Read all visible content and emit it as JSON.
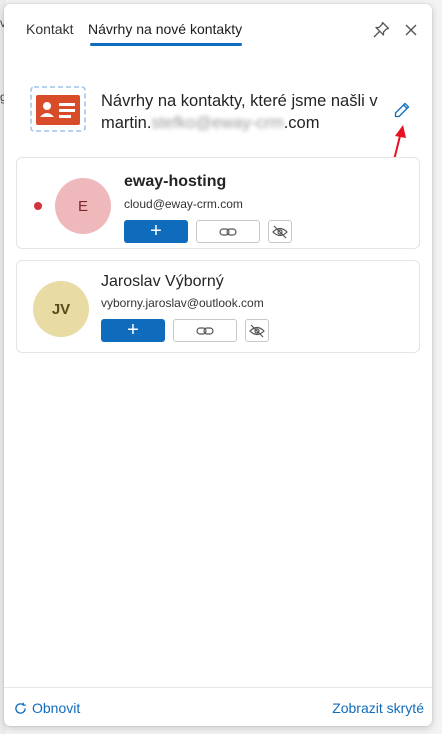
{
  "background": {
    "marks": [
      "v",
      "g"
    ]
  },
  "tabs": {
    "contacts": "Kontakt",
    "suggestions": "Návrhy na nové kontakty"
  },
  "header_icons": {
    "pin": "pin-icon",
    "close": "close-icon"
  },
  "intro": {
    "icon": "contact-card-icon",
    "text_line1": "Návrhy na kontakty, které jsme našli v",
    "email_prefix": "martin.",
    "email_blurred": "stefko@eway-crm",
    "email_suffix": ".com",
    "edit_icon": "pencil-icon"
  },
  "suggestions": [
    {
      "initials": "E",
      "name": "eway-hosting",
      "email": "cloud@eway-crm.com",
      "unread": true
    },
    {
      "initials": "JV",
      "name": "Jaroslav Výborný",
      "email": "vyborny.jaroslav@outlook.com",
      "unread": false
    }
  ],
  "actions": {
    "add": "+",
    "link_icon": "link-icon",
    "hide_icon": "eye-off-icon"
  },
  "footer": {
    "refresh": "Obnovit",
    "show_hidden": "Zobrazit skryté"
  },
  "colors": {
    "accent": "#0f6cbd",
    "unread": "#d13438",
    "annotation_arrow": "#e81123"
  }
}
